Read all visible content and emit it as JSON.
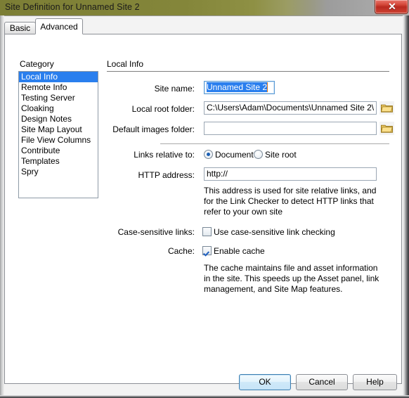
{
  "window": {
    "title": "Site Definition for Unnamed Site 2",
    "close_label": "✕"
  },
  "tabs": [
    {
      "id": "basic",
      "label": "Basic",
      "active": false
    },
    {
      "id": "advanced",
      "label": "Advanced",
      "active": true
    }
  ],
  "category": {
    "heading": "Category",
    "items": [
      {
        "label": "Local Info",
        "selected": true
      },
      {
        "label": "Remote Info",
        "selected": false
      },
      {
        "label": "Testing Server",
        "selected": false
      },
      {
        "label": "Cloaking",
        "selected": false
      },
      {
        "label": "Design Notes",
        "selected": false
      },
      {
        "label": "Site Map Layout",
        "selected": false
      },
      {
        "label": "File View Columns",
        "selected": false
      },
      {
        "label": "Contribute",
        "selected": false
      },
      {
        "label": "Templates",
        "selected": false
      },
      {
        "label": "Spry",
        "selected": false
      }
    ]
  },
  "section": {
    "title": "Local Info"
  },
  "fields": {
    "site_name": {
      "label": "Site name:",
      "value": "Unnamed Site 2",
      "selected": true,
      "focused": true
    },
    "local_root_folder": {
      "label": "Local root folder:",
      "value": "C:\\Users\\Adam\\Documents\\Unnamed Site 2\\",
      "browse_icon": "folder-icon"
    },
    "default_images_folder": {
      "label": "Default images folder:",
      "value": "",
      "browse_icon": "folder-icon"
    },
    "links_relative_to": {
      "label": "Links relative to:",
      "options": [
        {
          "label": "Document",
          "checked": true
        },
        {
          "label": "Site root",
          "checked": false
        }
      ]
    },
    "http_address": {
      "label": "HTTP address:",
      "value": "http://"
    },
    "http_help": "This address is used for site relative links, and for the Link Checker to detect HTTP links that refer to your own site",
    "case_sensitive_links": {
      "label": "Case-sensitive links:",
      "checkbox_label": "Use case-sensitive link checking",
      "checked": false
    },
    "cache": {
      "label": "Cache:",
      "checkbox_label": "Enable cache",
      "checked": true
    },
    "cache_help": "The cache maintains file and asset information in the site.  This speeds up the Asset panel, link management, and Site Map features."
  },
  "buttons": {
    "ok": "OK",
    "cancel": "Cancel",
    "help": "Help"
  },
  "colors": {
    "titlebar_start": "#7c7e35",
    "selection_blue": "#2a7fee",
    "default_button_border": "#3c7fb1",
    "close_red": "#b92a20",
    "folder_gold": "#e8b93c"
  }
}
